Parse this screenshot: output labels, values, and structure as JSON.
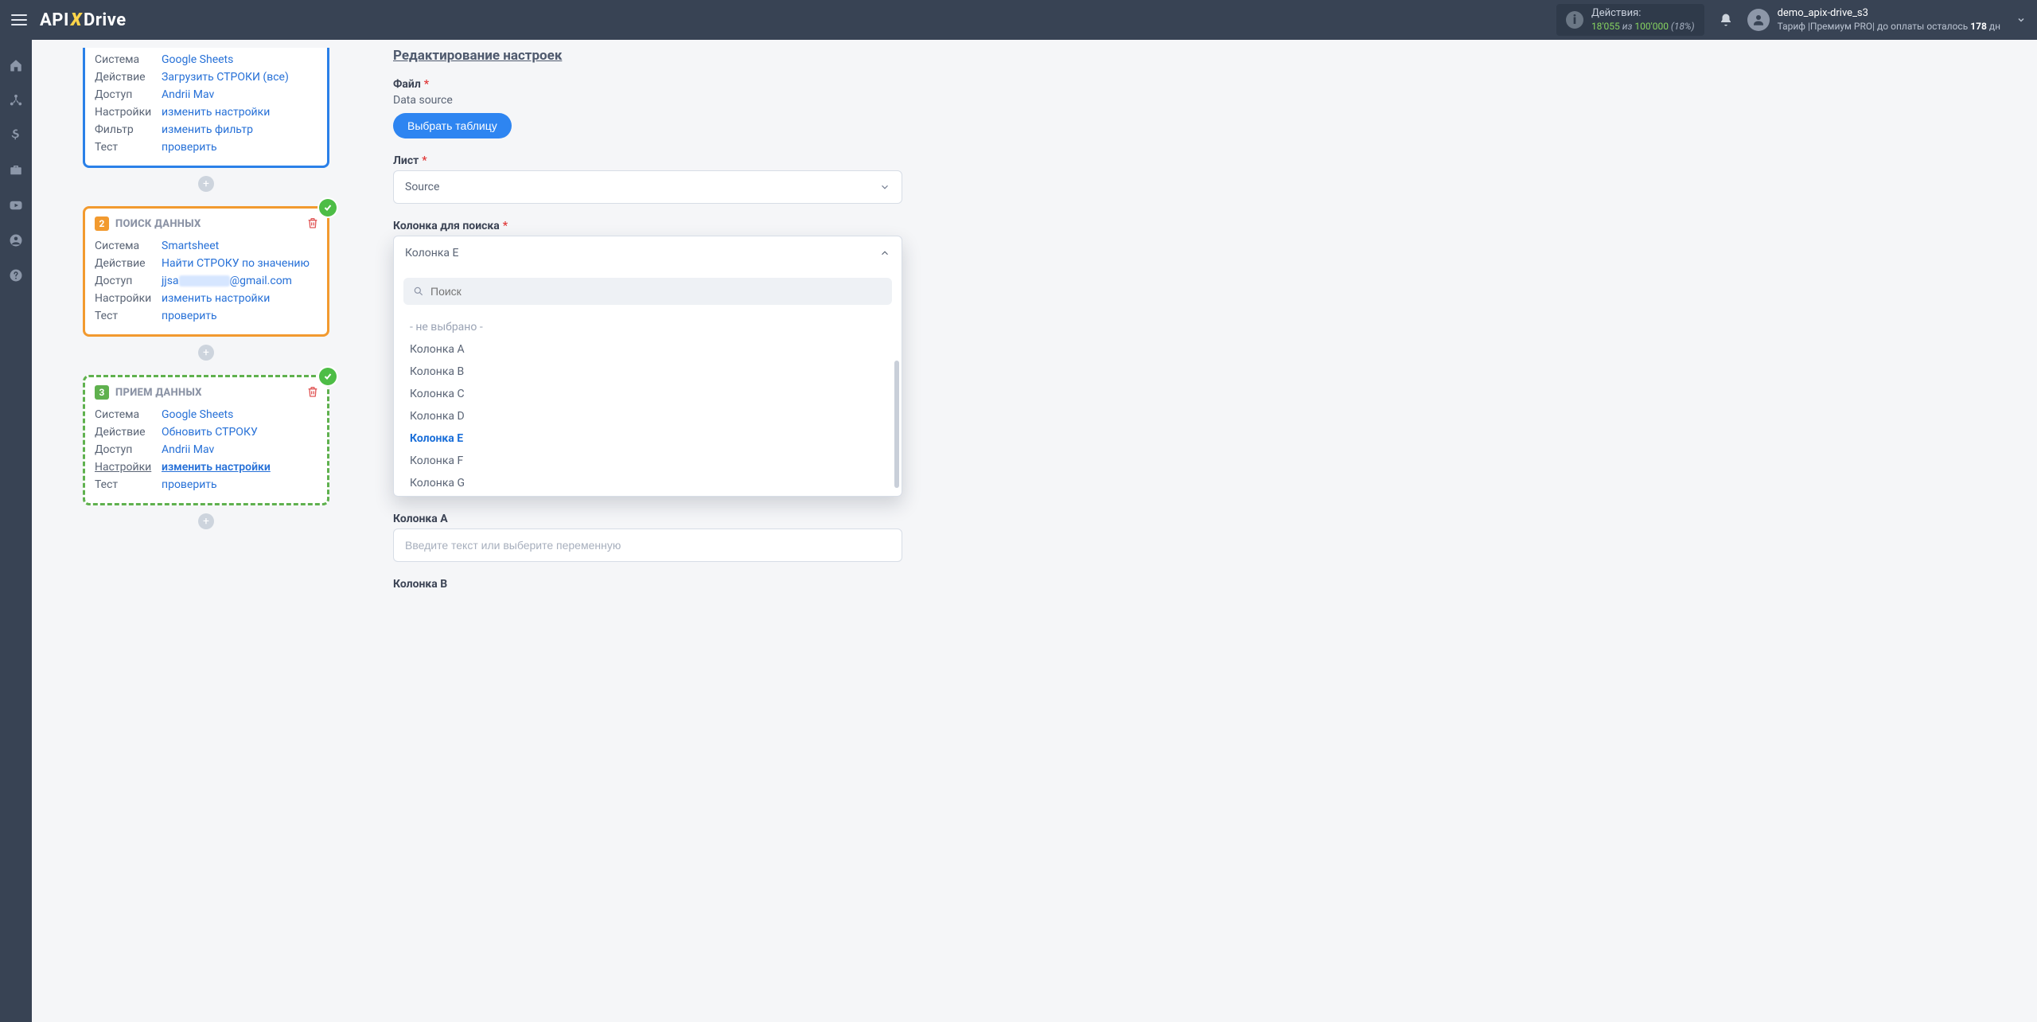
{
  "header": {
    "logo": {
      "p1": "API",
      "p2": "X",
      "p3": "Drive"
    },
    "actions": {
      "label": "Действия:",
      "used": "18'055",
      "of_word": "из",
      "total": "100'000",
      "percent": "(18%)"
    },
    "user": {
      "name": "demo_apix-drive_s3",
      "tariff_prefix": "Тариф |Премиум PRO| до оплаты осталось ",
      "days": "178",
      "days_suffix": " дн"
    }
  },
  "steps": {
    "s1": {
      "rows": {
        "system_k": "Система",
        "system_v": "Google Sheets",
        "action_k": "Действие",
        "action_v": "Загрузить СТРОКИ (все)",
        "access_k": "Доступ",
        "access_v": "Andrii Mav",
        "settings_k": "Настройки",
        "settings_v": "изменить настройки",
        "filter_k": "Фильтр",
        "filter_v": "изменить фильтр",
        "test_k": "Тест",
        "test_v": "проверить"
      }
    },
    "s2": {
      "num": "2",
      "title": "ПОИСК ДАННЫХ",
      "rows": {
        "system_k": "Система",
        "system_v": "Smartsheet",
        "action_k": "Действие",
        "action_v": "Найти СТРОКУ по значению",
        "access_k": "Доступ",
        "access_pre": "jjsa",
        "access_post": "@gmail.com",
        "settings_k": "Настройки",
        "settings_v": "изменить настройки",
        "test_k": "Тест",
        "test_v": "проверить"
      }
    },
    "s3": {
      "num": "3",
      "title": "ПРИЕМ ДАННЫХ",
      "rows": {
        "system_k": "Система",
        "system_v": "Google Sheets",
        "action_k": "Действие",
        "action_v": "Обновить СТРОКУ",
        "access_k": "Доступ",
        "access_v": "Andrii Mav",
        "settings_k": "Настройки",
        "settings_v": "изменить настройки",
        "test_k": "Тест",
        "test_v": "проверить"
      }
    }
  },
  "form": {
    "title": "Редактирование настроек",
    "file_label": "Файл",
    "file_sub": "Data source",
    "file_btn": "Выбрать таблицу",
    "sheet_label": "Лист",
    "sheet_value": "Source",
    "col_label": "Колонка для поиска",
    "col_value": "Колонка E",
    "search_placeholder": "Поиск",
    "options": {
      "none": "- не выбрано -",
      "a": "Колонка A",
      "b": "Колонка B",
      "c": "Колонка C",
      "d": "Колонка D",
      "e": "Колонка E",
      "f": "Колонка F",
      "g": "Колонка G"
    },
    "colA_label": "Колонка A",
    "colA_placeholder": "Введите текст или выберите переменную",
    "colB_label": "Колонка B"
  }
}
